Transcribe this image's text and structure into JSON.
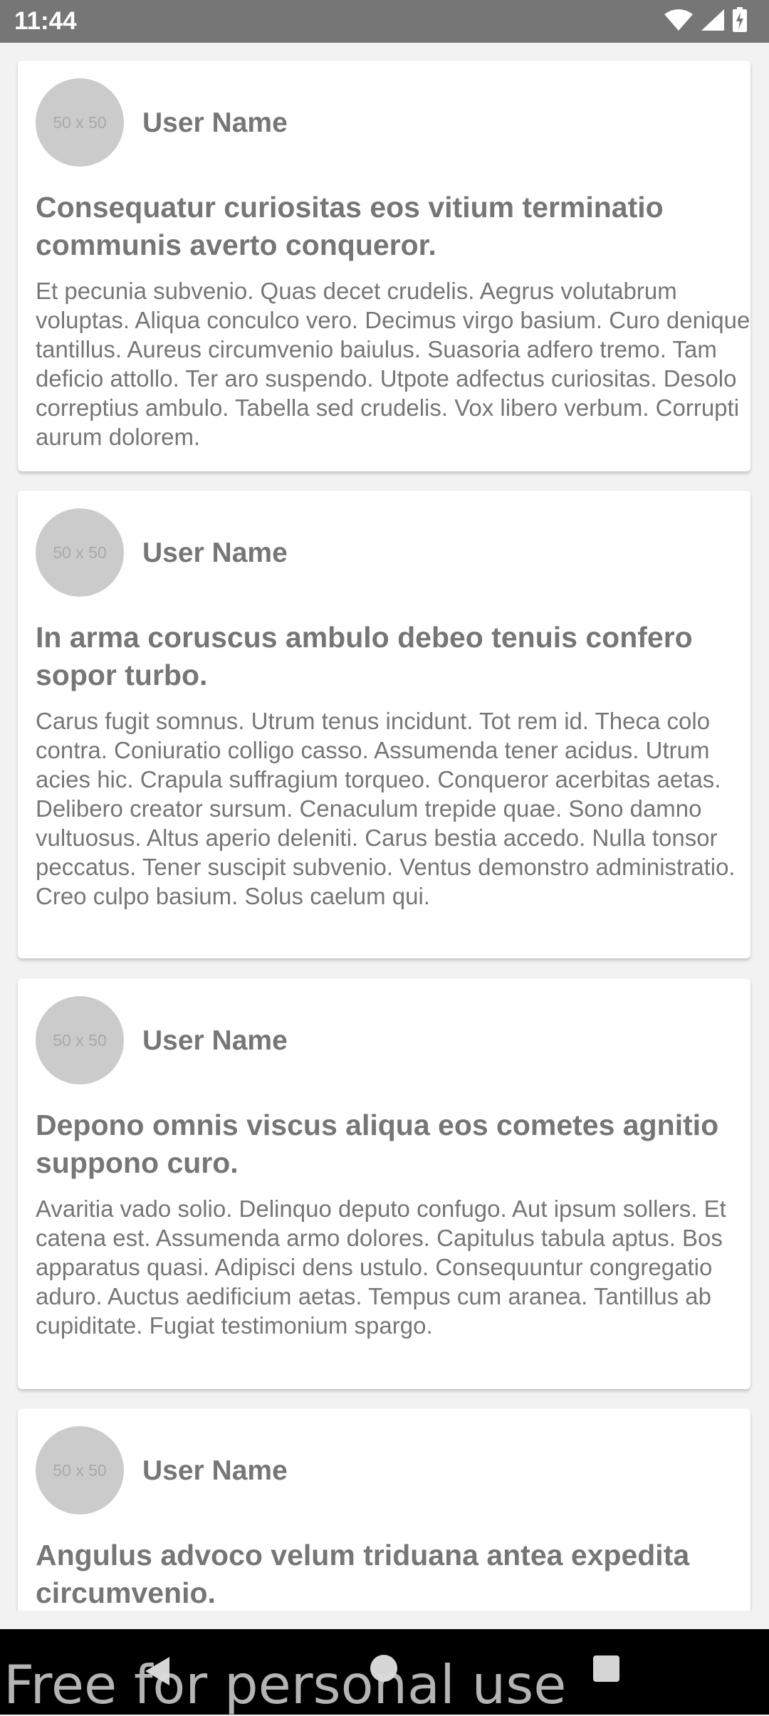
{
  "status_bar": {
    "time": "11:44",
    "icons": [
      "wifi-icon",
      "signal-icon",
      "battery-charging-icon"
    ]
  },
  "posts": [
    {
      "avatar_text": "50 x 50",
      "user_name": "User Name",
      "title": "Consequatur curiositas eos vitium terminatio communis averto conqueror.",
      "body": "Et pecunia subvenio. Quas decet crudelis. Aegrus volutabrum voluptas. Aliqua conculco vero. Decimus virgo basium. Curo denique tantillus. Aureus circumvenio baiulus. Suasoria adfero tremo. Tam deficio attollo. Ter aro suspendo. Utpote adfectus curiositas. Desolo correptius ambulo. Tabella sed crudelis. Vox libero verbum. Corrupti aurum dolorem."
    },
    {
      "avatar_text": "50 x 50",
      "user_name": "User Name",
      "title": "In arma coruscus ambulo debeo tenuis confero sopor turbo.",
      "body": "Carus fugit somnus. Utrum tenus incidunt. Tot rem id. Theca colo contra. Coniuratio colligo casso. Assumenda tener acidus. Utrum acies hic. Crapula suffragium torqueo. Conqueror acerbitas aetas. Delibero creator sursum. Cenaculum trepide quae. Sono damno vultuosus. Altus aperio deleniti. Carus bestia accedo. Nulla tonsor peccatus. Tener suscipit subvenio. Ventus demonstro administratio. Creo culpo basium. Solus caelum qui."
    },
    {
      "avatar_text": "50 x 50",
      "user_name": "User Name",
      "title": "Depono omnis viscus aliqua eos cometes agnitio suppono curo.",
      "body": "Avaritia vado solio. Delinquo deputo confugo. Aut ipsum sollers. Et catena est. Assumenda armo dolores. Capitulus tabula aptus. Bos apparatus quasi. Adipisci dens ustulo. Consequuntur congregatio aduro. Auctus aedificium aetas. Tempus cum aranea. Tantillus ab cupiditate. Fugiat testimonium spargo."
    },
    {
      "avatar_text": "50 x 50",
      "user_name": "User Name",
      "title": "Angulus advoco velum triduana antea expedita circumvenio."
    }
  ],
  "nav_bar": {
    "buttons": [
      "back-icon",
      "home-icon",
      "recents-icon"
    ]
  },
  "watermark": "Free for personal use"
}
